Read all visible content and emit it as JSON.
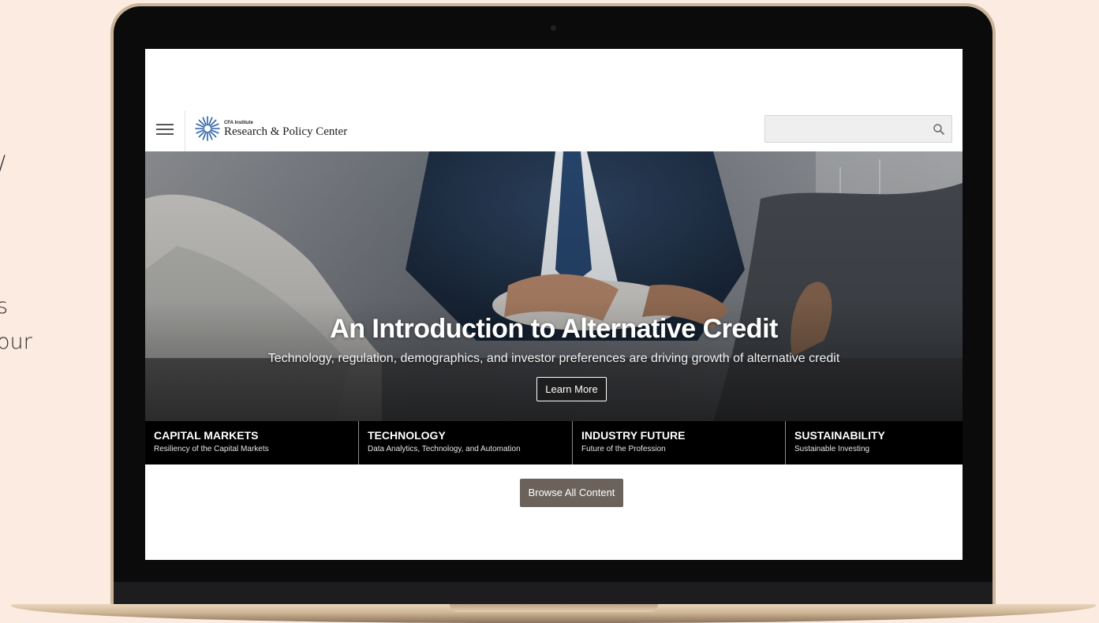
{
  "edge_text": {
    "line1": "/",
    "line2": "s",
    "line3": "our"
  },
  "header": {
    "logo_org": "CFA Institute",
    "logo_name": "Research & Policy Center",
    "search_placeholder": ""
  },
  "icons": {
    "menu": "hamburger-menu-icon",
    "search": "search-icon",
    "logo": "cfa-globe-logo"
  },
  "hero": {
    "title": "An Introduction to Alternative Credit",
    "subtitle": "Technology, regulation, demographics, and investor preferences are driving growth of alternative credit",
    "button_label": "Learn More"
  },
  "categories": [
    {
      "title": "CAPITAL MARKETS",
      "subtitle": "Resiliency of the Capital Markets"
    },
    {
      "title": "TECHNOLOGY",
      "subtitle": "Data Analytics, Technology, and Automation"
    },
    {
      "title": "INDUSTRY FUTURE",
      "subtitle": "Future of the Profession"
    },
    {
      "title": "SUSTAINABILITY",
      "subtitle": "Sustainable Investing"
    }
  ],
  "browse_button_label": "Browse All Content",
  "colors": {
    "page_background": "#fcebe1",
    "category_bar": "#000000",
    "browse_button": "#6b625b",
    "logo_blue": "#2a5fa8"
  }
}
